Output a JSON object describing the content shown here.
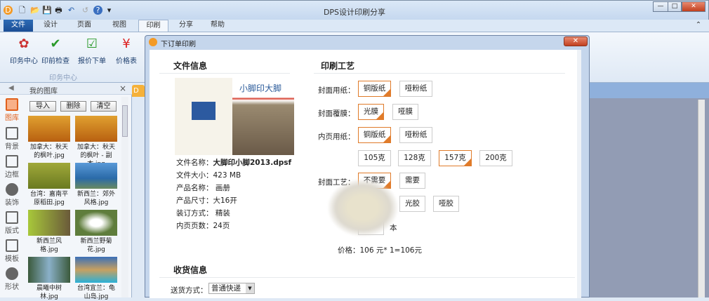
{
  "window": {
    "title": "DPS设计印刷分享",
    "minimize": "—",
    "maximize": "□",
    "close": "✕"
  },
  "quick_access": [
    "D",
    "🗋",
    "📂",
    "💾",
    "🖶",
    "↶",
    "↺",
    "?",
    "▾"
  ],
  "tabs": [
    "文件",
    "设计",
    "页面",
    "视图",
    "印刷",
    "分享",
    "帮助"
  ],
  "active_tab": "印刷",
  "ribbon": {
    "buttons": [
      {
        "label": "印务中心",
        "icon": "printer-colors-icon"
      },
      {
        "label": "印前检查",
        "icon": "checklist-icon"
      },
      {
        "label": "报价下单",
        "icon": "order-check-icon"
      },
      {
        "label": "价格表",
        "icon": "yen-icon"
      }
    ],
    "group": "印务中心",
    "collapse": "⌃"
  },
  "left_panel": {
    "title": "我的图库",
    "collapse": "◀",
    "close": "×",
    "categories": [
      "图库",
      "背景",
      "边框",
      "装饰",
      "版式",
      "模板",
      "形状"
    ],
    "buttons": [
      "导入",
      "删除",
      "清空"
    ],
    "images": [
      {
        "name": "加拿大：秋天的枫叶.jpg",
        "color": "#d8891c"
      },
      {
        "name": "加拿大：秋天的枫叶 - 副本.jpg",
        "color": "#d8891c"
      },
      {
        "name": "台湾：嘉南平原稻田.jpg",
        "color": "#8a9a2a"
      },
      {
        "name": "新西兰：郊外风格.jpg",
        "color": "#2d6fb0"
      },
      {
        "name": "新西兰风格.jpg",
        "color": "#7fa83a"
      },
      {
        "name": "新西兰野菊花.jpg",
        "color": "#5f7d3c"
      },
      {
        "name": "晨曦中树林.jpg",
        "color": "#3b5a3c"
      },
      {
        "name": "台湾宜兰：龟山岛.jpg",
        "color": "#2aa0c8"
      }
    ]
  },
  "doc_tab": "D",
  "dialog": {
    "title": "下订单印刷",
    "close": "✕",
    "file_info": {
      "heading": "文件信息",
      "cover_title": "小脚印大脚",
      "rows": [
        {
          "label": "文件名称：",
          "value": "大脚印小脚2013.dpsf"
        },
        {
          "label": "文件大小：",
          "value": "423 MB"
        },
        {
          "label": "产品名称：",
          "value": " 画册"
        },
        {
          "label": "产品尺寸：",
          "value": "大16开"
        },
        {
          "label": "装订方式：",
          "value": " 精装"
        },
        {
          "label": "内页页数：",
          "value": "24页"
        }
      ]
    },
    "craft": {
      "heading": "印刷工艺",
      "cover_paper": {
        "label": "封面用纸：",
        "options": [
          "铜版纸",
          "哑粉纸"
        ],
        "selected": "铜版纸"
      },
      "cover_film": {
        "label": "封面覆膜：",
        "options": [
          "光膜",
          "哑膜"
        ],
        "selected": "光膜"
      },
      "inner_paper": {
        "label": "内页用纸：",
        "options": [
          "铜版纸",
          "哑粉纸"
        ],
        "selected": "铜版纸"
      },
      "weight": {
        "options": [
          "105克",
          "128克",
          "157克",
          "200克"
        ],
        "selected": "157克"
      },
      "cover_process": {
        "label": "封面工艺：",
        "options": [
          "不需要",
          "需要"
        ],
        "selected": "不需要"
      },
      "glue": {
        "options": [
          "光胶",
          "哑胶"
        ]
      },
      "quantity_unit": "本",
      "price": "价格：106 元* 1=106元"
    },
    "shipping": {
      "heading": "收货信息",
      "method_label": "送货方式：",
      "method_value": "普通快递"
    }
  }
}
